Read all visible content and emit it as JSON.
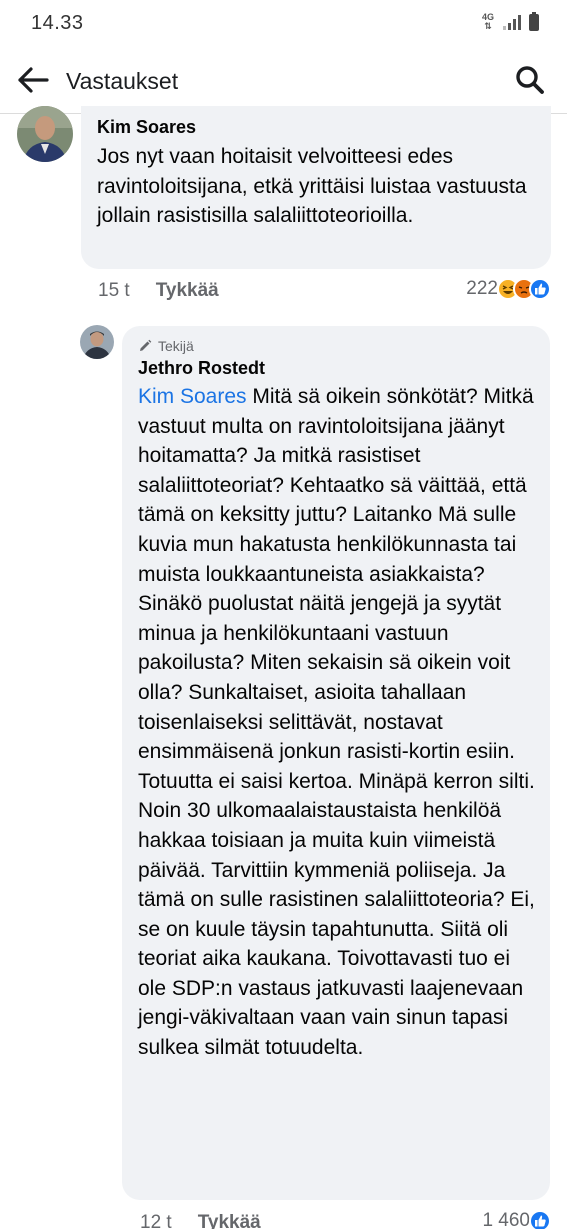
{
  "status_bar": {
    "time": "14.33",
    "network": "4G",
    "signal_icon": "signal-icon",
    "battery_icon": "battery-icon"
  },
  "header": {
    "title": "Vastaukset",
    "back_icon": "arrow-left-icon",
    "search_icon": "search-icon"
  },
  "comments": [
    {
      "author": "Kim Soares",
      "text": "Jos nyt vaan hoitaisit velvoitteesi edes ravintoloitsijana, etkä yrittäisi luistaa vastuusta jollain rasistisilla salaliittoteorioilla.",
      "time": "15 t",
      "like_label": "Tykkää",
      "reaction_count": "222",
      "reactions": [
        "haha-icon",
        "angry-icon",
        "like-icon"
      ]
    },
    {
      "badge": "Tekijä",
      "badge_icon": "pencil-icon",
      "author": "Jethro Rostedt",
      "mention": "Kim Soares",
      "text": " Mitä sä oikein sönkötät? Mitkä vastuut multa on ravintoloitsijana jäänyt hoitamatta? Ja mitkä rasistiset salaliittoteoriat? Kehtaatko sä väittää, että tämä on keksitty juttu? Laitanko Mä sulle kuvia mun hakatusta henkilökunnasta tai muista loukkaantuneista asiakkaista? Sinäkö puolustat näitä jengejä ja syytät minua ja henkilökuntaani vastuun pakoilusta? Miten sekaisin sä oikein voit olla? Sunkaltaiset, asioita tahallaan toisenlaiseksi selittävät, nostavat ensimmäisenä jonkun rasisti-kortin esiin. Totuutta ei saisi kertoa. Minäpä kerron silti. Noin 30 ulkomaalaistaustaista henkilöä hakkaa toisiaan ja muita kuin viimeistä päivää. Tarvittiin kymmeniä poliiseja. Ja tämä on sulle rasistinen salaliittoteoria? Ei, se on kuule täysin tapahtunutta. Siitä oli teoriat aika kaukana. Toivottavasti tuo ei ole SDP:n vastaus jatkuvasti laajenevaan jengi-väkivaltaan vaan vain sinun tapasi sulkea silmät totuudelta.",
      "time": "12 t",
      "like_label": "Tykkää",
      "reaction_count": "1 460",
      "reactions": [
        "like-icon"
      ]
    }
  ],
  "colors": {
    "bubble": "#f0f2f5",
    "mention": "#1b74e4",
    "meta": "#65676b",
    "like_blue": "#1877f2",
    "haha_yellow": "#f7b125",
    "angry_orange": "#e9710f"
  }
}
